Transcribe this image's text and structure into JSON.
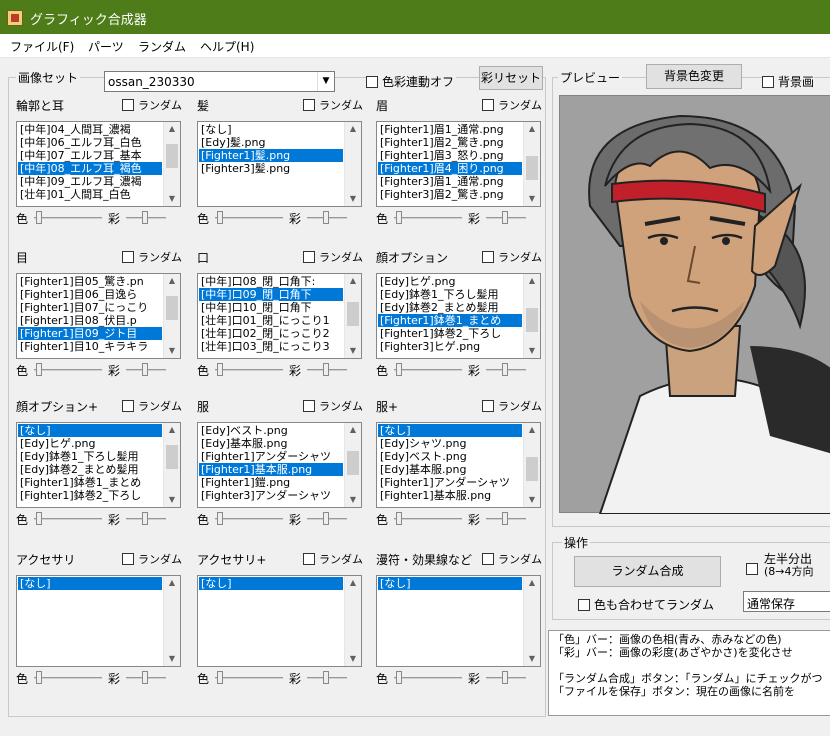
{
  "window": {
    "title": "グラフィック合成器"
  },
  "menu": [
    "ファイル(F)",
    "パーツ",
    "ランダム",
    "ヘルプ(H)"
  ],
  "imageset": {
    "label": "画像セット",
    "value": "ossan_230330",
    "color_link_label": "色彩連動オフ",
    "saturation_reset": "彩リセット"
  },
  "preview": {
    "label": "プレビュー",
    "bgcolor_button": "背景色変更",
    "bg_checkbox": "背景画"
  },
  "random_label": "ランダム",
  "color_label": "色",
  "sat_label": "彩",
  "sections": [
    {
      "name": "輪郭と耳",
      "items": [
        "[中年]04_人間耳_濃褐",
        "[中年]06_エルフ耳_白色",
        "[中年]07_エルフ耳_基本",
        "[中年]08_エルフ耳_褐色",
        "[中年]09_エルフ耳_濃褐",
        "[壮年]01_人間耳_白色"
      ],
      "selected": 3
    },
    {
      "name": "髪",
      "items": [
        "[なし]",
        "[Edy]髪.png",
        "[Fighter1]髪.png",
        "[Fighter3]髪.png"
      ],
      "selected": 2
    },
    {
      "name": "眉",
      "items": [
        "[Fighter1]眉1_通常.png",
        "[Fighter1]眉2_驚き.png",
        "[Fighter1]眉3_怒り.png",
        "[Fighter1]眉4_困り.png",
        "[Fighter3]眉1_通常.png",
        "[Fighter3]眉2_驚き.png"
      ],
      "selected": 3
    },
    {
      "name": "目",
      "items": [
        "[Fighter1]目05_驚き.pn",
        "[Fighter1]目06_目逸ら",
        "[Fighter1]目07_にっこり",
        "[Fighter1]目08_伏目.p",
        "[Fighter1]目09_ジト目",
        "[Fighter1]目10_キラキラ"
      ],
      "selected": 4
    },
    {
      "name": "口",
      "items": [
        "[中年]口08_閉_口角下:",
        "[中年]口09_閉_口角下",
        "[中年]口10_閉_口角下",
        "[壮年]口01_閉_にっこり1",
        "[壮年]口02_閉_にっこり2",
        "[壮年]口03_閉_にっこり3"
      ],
      "selected": 1
    },
    {
      "name": "顔オプション",
      "items": [
        "[Edy]ヒゲ.png",
        "[Edy]鉢巻1_下ろし髪用",
        "[Edy]鉢巻2_まとめ髪用",
        "[Fighter1]鉢巻1_まとめ",
        "[Fighter1]鉢巻2_下ろし",
        "[Fighter3]ヒゲ.png"
      ],
      "selected": 3
    },
    {
      "name": "顔オプション+",
      "items": [
        "[なし]",
        "[Edy]ヒゲ.png",
        "[Edy]鉢巻1_下ろし髪用",
        "[Edy]鉢巻2_まとめ髪用",
        "[Fighter1]鉢巻1_まとめ",
        "[Fighter1]鉢巻2_下ろし"
      ],
      "selected": 0
    },
    {
      "name": "服",
      "items": [
        "[Edy]ベスト.png",
        "[Edy]基本服.png",
        "[Fighter1]アンダーシャツ",
        "[Fighter1]基本服.png",
        "[Fighter1]鎧.png",
        "[Fighter3]アンダーシャツ"
      ],
      "selected": 3
    },
    {
      "name": "服+",
      "items": [
        "[なし]",
        "[Edy]シャツ.png",
        "[Edy]ベスト.png",
        "[Edy]基本服.png",
        "[Fighter1]アンダーシャツ",
        "[Fighter1]基本服.png"
      ],
      "selected": 0
    },
    {
      "name": "アクセサリ",
      "items": [
        "[なし]"
      ],
      "selected": 0
    },
    {
      "name": "アクセサリ+",
      "items": [
        "[なし]"
      ],
      "selected": 0
    },
    {
      "name": "漫符・効果線など",
      "items": [
        "[なし]"
      ],
      "selected": 0
    }
  ],
  "operations": {
    "label": "操作",
    "random_button": "ランダム合成",
    "half_output_line1": "左半分出",
    "half_output_line2": "(8→4方向",
    "color_random": "色も合わせてランダム",
    "save_mode": "通常保存"
  },
  "status": [
    "「色」バー：画像の色相(青み、赤みなどの色)",
    "「彩」バー：画像の彩度(あざやかさ)を変化させ",
    "",
    "「ランダム合成」ボタン：「ランダム」にチェックがつ",
    "「ファイルを保存」ボタン：現在の画像に名前を"
  ]
}
